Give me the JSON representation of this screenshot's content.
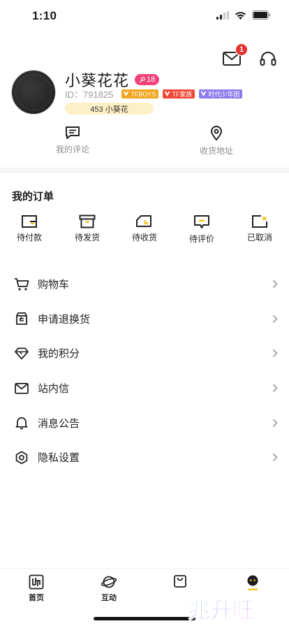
{
  "status_bar": {
    "time": "1:10"
  },
  "header": {
    "message_badge": "1"
  },
  "profile": {
    "username": "小葵花花",
    "level": "18",
    "user_id": "ID：791825",
    "tags": [
      {
        "label": "TFBOYS",
        "color": "#f2a51e"
      },
      {
        "label": "TF家族",
        "color": "#ef4836"
      },
      {
        "label": "时代少年团",
        "color": "#8d7cf0"
      }
    ],
    "points": "453 小葵花"
  },
  "quick_links": [
    {
      "label": "我的评论",
      "icon": "comment-icon"
    },
    {
      "label": "收货地址",
      "icon": "location-pin-icon"
    }
  ],
  "orders": {
    "title": "我的订单",
    "items": [
      {
        "label": "待付款",
        "icon": "wallet-icon"
      },
      {
        "label": "待发货",
        "icon": "box-icon"
      },
      {
        "label": "待收货",
        "icon": "truck-icon"
      },
      {
        "label": "待评价",
        "icon": "review-icon"
      },
      {
        "label": "已取消",
        "icon": "cancelled-icon"
      }
    ]
  },
  "menu": [
    {
      "label": "购物车",
      "icon": "cart-icon"
    },
    {
      "label": "申请退换货",
      "icon": "return-icon"
    },
    {
      "label": "我的积分",
      "icon": "diamond-icon"
    },
    {
      "label": "站内信",
      "icon": "mail-icon"
    },
    {
      "label": "消息公告",
      "icon": "bell-icon"
    },
    {
      "label": "隐私设置",
      "icon": "settings-icon"
    }
  ],
  "tab_bar": [
    {
      "label": "首页",
      "icon": "home-icon"
    },
    {
      "label": "互动",
      "icon": "planet-icon"
    },
    {
      "label": "",
      "icon": "shopping-bag-icon"
    },
    {
      "label": "",
      "icon": "profile-face-icon",
      "active": true
    }
  ],
  "watermark": {
    "text": "兆升旺"
  },
  "colors": {
    "accent_yellow": "#f5c518",
    "badge_red": "#e8312d",
    "level_pink": "#f0437a"
  }
}
